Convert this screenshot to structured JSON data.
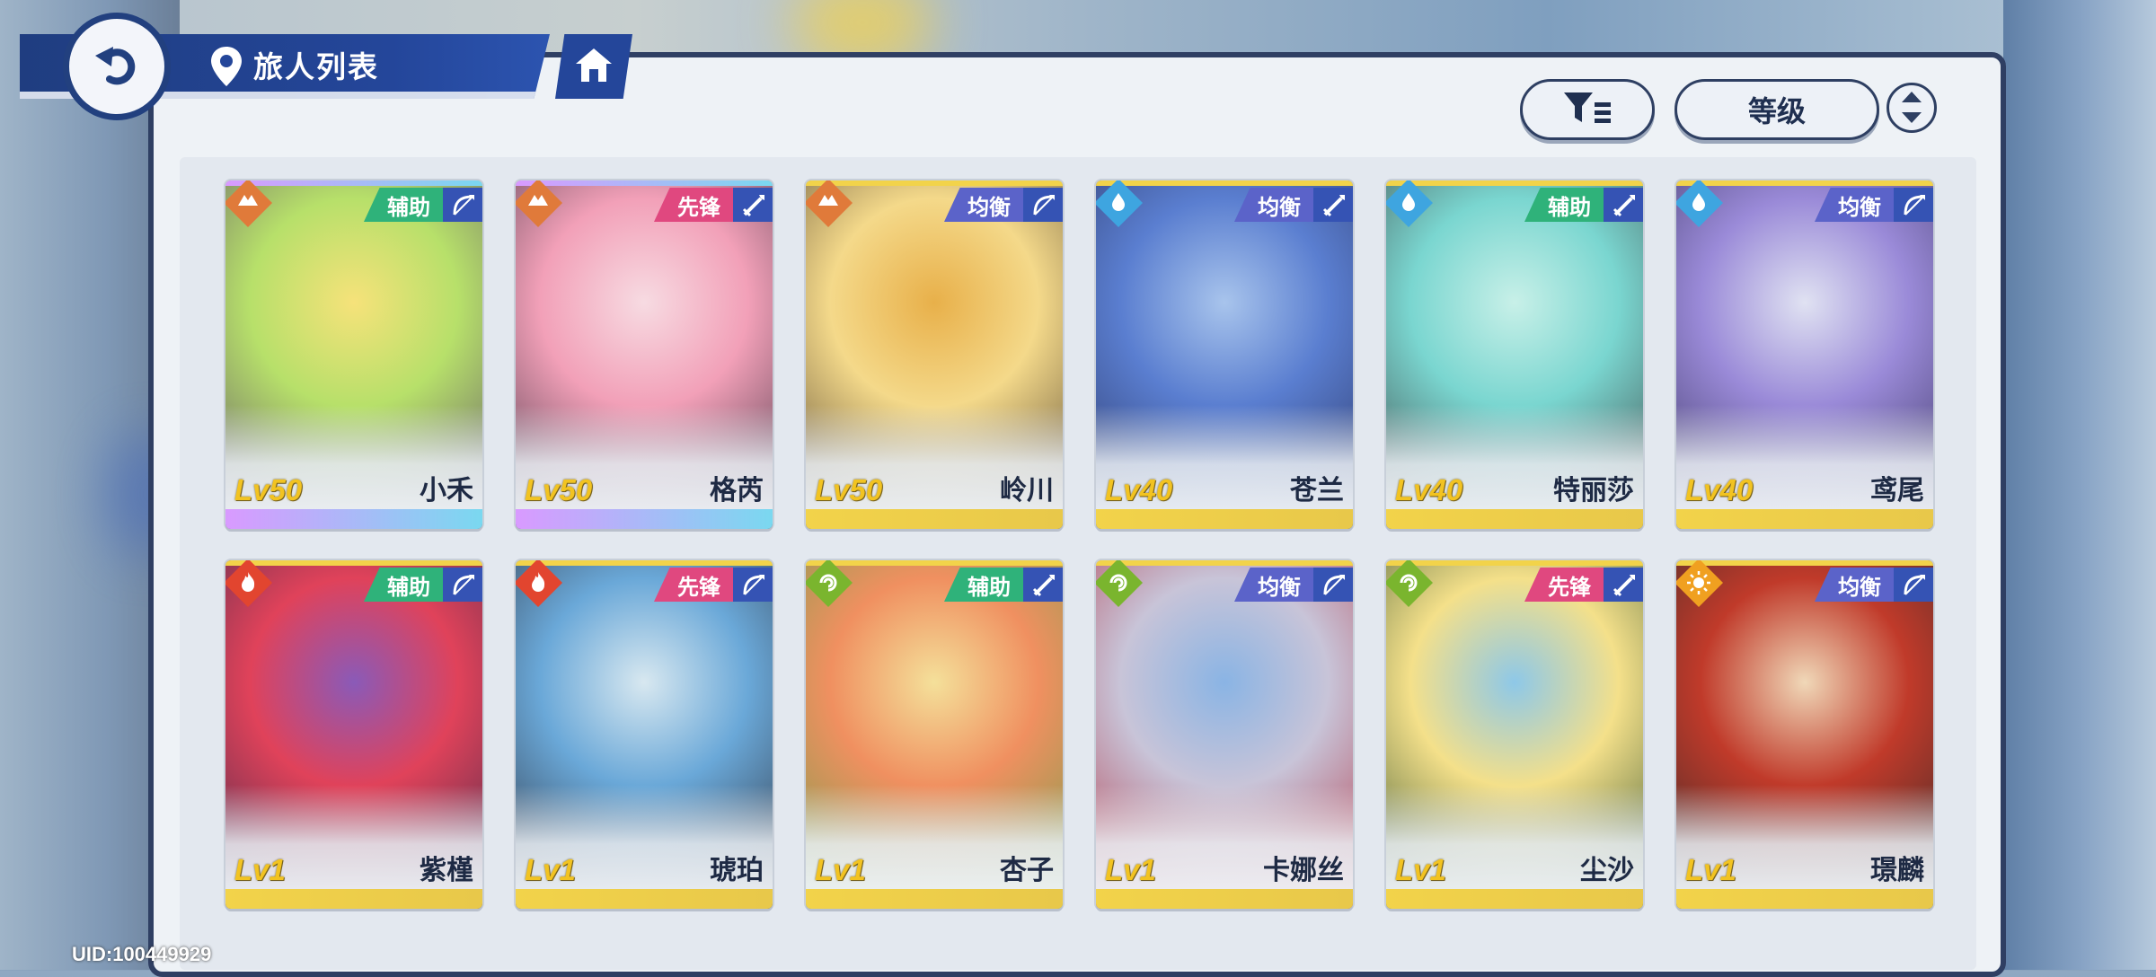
{
  "header": {
    "title": "旅人列表"
  },
  "controls": {
    "sort_label": "等级"
  },
  "footer": {
    "uid": "UID:100449929"
  },
  "colors": {
    "navy": "#24469a",
    "support": "#2fb27a",
    "vanguard": "#e0487f",
    "balance": "#5b63c9",
    "level_gold": "#f2c321"
  },
  "cards": [
    {
      "name": "小禾",
      "level": "Lv50",
      "role": "辅助",
      "element": "earth",
      "weapon": "bow"
    },
    {
      "name": "格芮",
      "level": "Lv50",
      "role": "先锋",
      "element": "earth",
      "weapon": "sword"
    },
    {
      "name": "岭川",
      "level": "Lv50",
      "role": "均衡",
      "element": "earth",
      "weapon": "bow"
    },
    {
      "name": "苍兰",
      "level": "Lv40",
      "role": "均衡",
      "element": "water",
      "weapon": "sword"
    },
    {
      "name": "特丽莎",
      "level": "Lv40",
      "role": "辅助",
      "element": "water",
      "weapon": "sword"
    },
    {
      "name": "鸢尾",
      "level": "Lv40",
      "role": "均衡",
      "element": "water",
      "weapon": "bow"
    },
    {
      "name": "紫槿",
      "level": "Lv1",
      "role": "辅助",
      "element": "fire",
      "weapon": "bow"
    },
    {
      "name": "琥珀",
      "level": "Lv1",
      "role": "先锋",
      "element": "fire",
      "weapon": "bow"
    },
    {
      "name": "杏子",
      "level": "Lv1",
      "role": "辅助",
      "element": "wind",
      "weapon": "sword"
    },
    {
      "name": "卡娜丝",
      "level": "Lv1",
      "role": "均衡",
      "element": "wind",
      "weapon": "bow"
    },
    {
      "name": "尘沙",
      "level": "Lv1",
      "role": "先锋",
      "element": "wind",
      "weapon": "sword"
    },
    {
      "name": "璟麟",
      "level": "Lv1",
      "role": "均衡",
      "element": "light",
      "weapon": "bow"
    }
  ]
}
